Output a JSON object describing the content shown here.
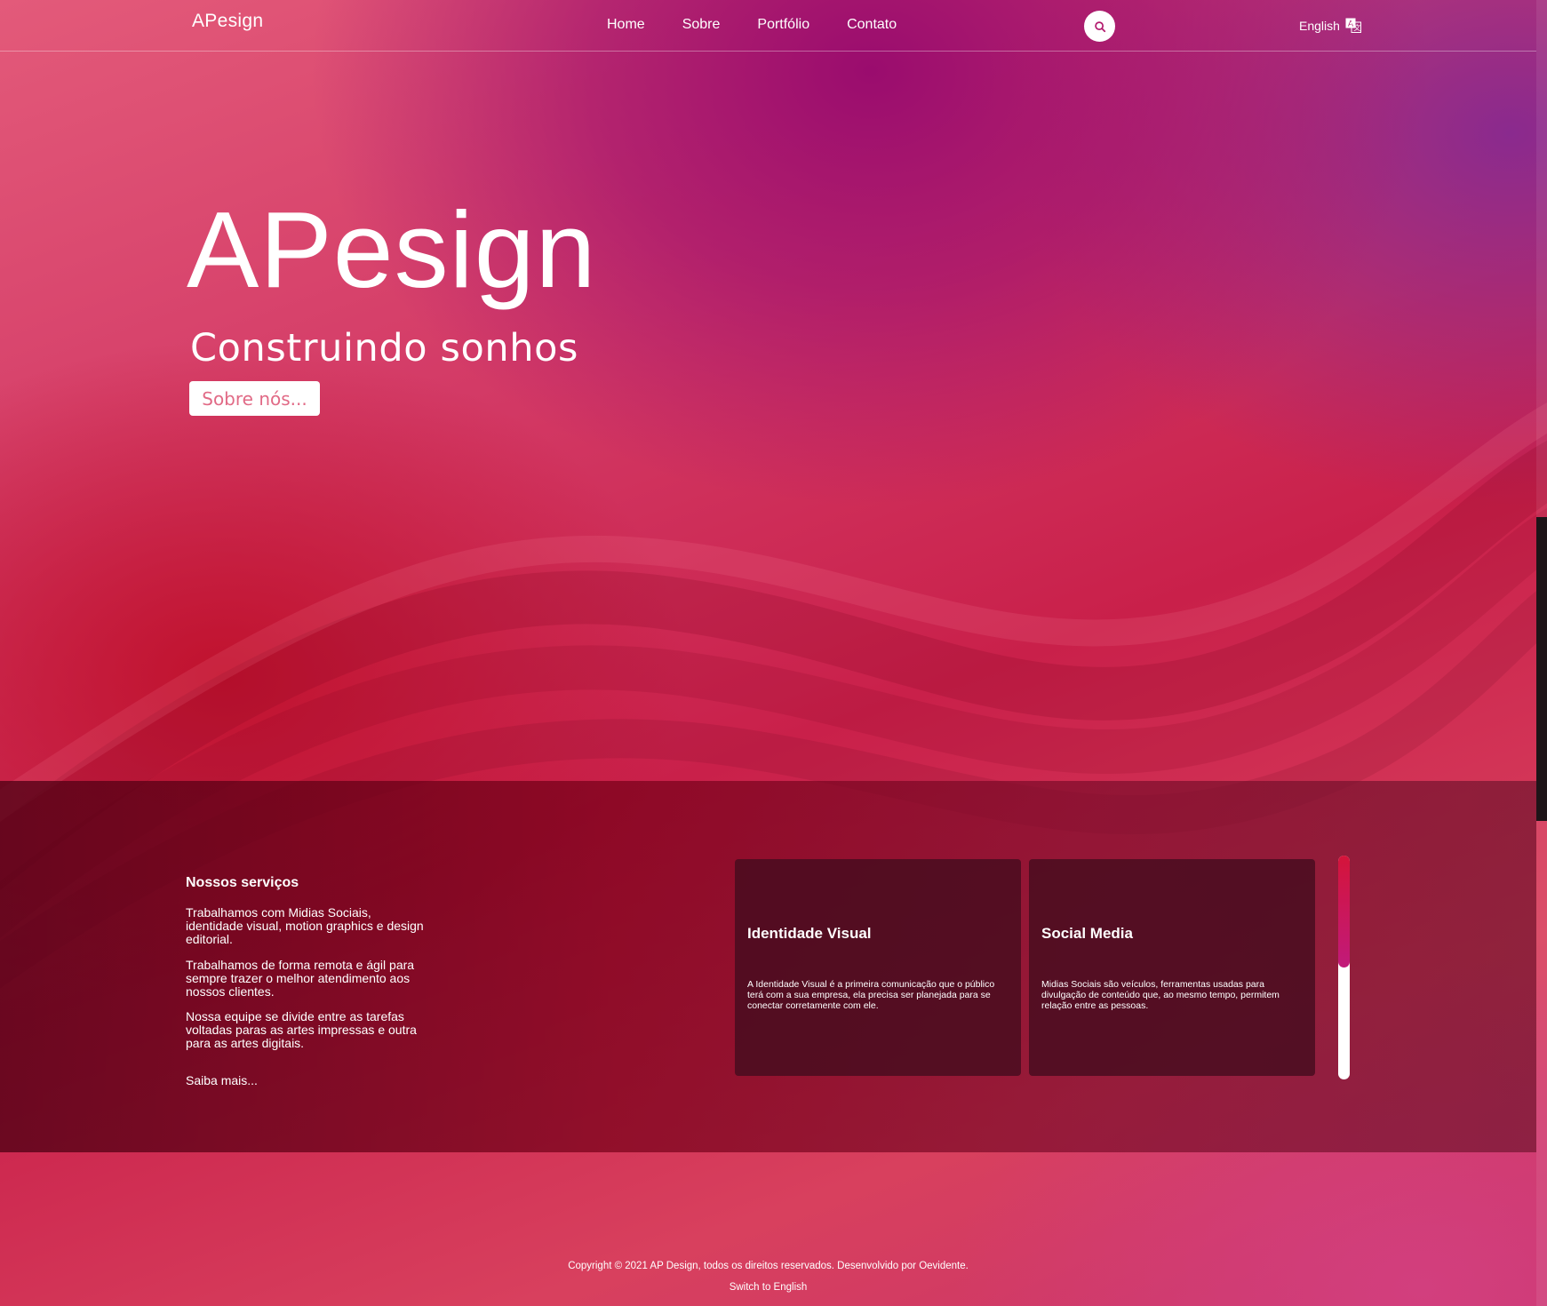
{
  "header": {
    "brand": "APesign",
    "nav": [
      "Home",
      "Sobre",
      "Portfólio",
      "Contato"
    ],
    "language": "English",
    "search_icon": "search-icon",
    "translate_icon": "translate-icon"
  },
  "hero": {
    "logo": "APesign",
    "tagline": "Construindo sonhos",
    "cta": "Sobre nós..."
  },
  "services": {
    "title": "Nossos serviços",
    "paragraphs": [
      "Trabalhamos com Midias Sociais, identidade visual, motion graphics e design editorial.",
      "Trabalhamos de forma remota e ágil para sempre trazer o melhor atendimento aos nossos clientes.",
      "Nossa equipe se divide entre as tarefas voltadas paras as artes impressas e outra para as artes digitais."
    ],
    "more": "Saiba mais...",
    "cards": [
      {
        "title": "Identidade Visual",
        "body": "A Identidade Visual é a primeira comunicação que o público terá com a sua empresa, ela precisa ser planejada para se conectar corretamente com ele."
      },
      {
        "title": "Social Media",
        "body": "Midias Sociais são veículos, ferramentas usadas para divulgação de conteúdo que, ao mesmo tempo, permitem relação entre as pessoas."
      }
    ],
    "carousel_progress": 0.5
  },
  "footer": {
    "copyright": "Copyright © 2021 AP Design, todos os direitos reservados. Desenvolvido por Oevidente.",
    "switch": "Switch to English"
  },
  "colors": {
    "accent": "#e16a86",
    "band": "#6a0a1e",
    "scroll_thumb": "#d4143a"
  }
}
